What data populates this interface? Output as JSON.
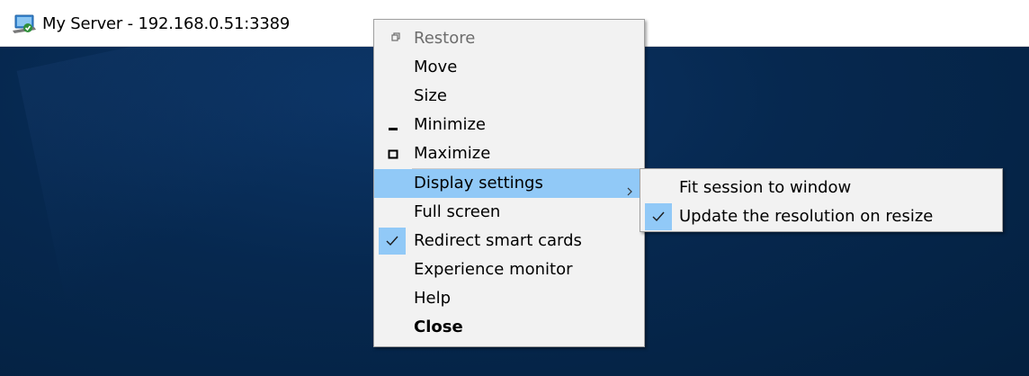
{
  "window": {
    "title": "My Server - 192.168.0.51:3389",
    "app_icon": "remote-desktop-icon"
  },
  "system_menu": {
    "items": [
      {
        "label": "Restore",
        "icon": "restore-icon",
        "state": "disabled"
      },
      {
        "label": "Move"
      },
      {
        "label": "Size"
      },
      {
        "label": "Minimize",
        "icon": "minimize-icon"
      },
      {
        "label": "Maximize",
        "icon": "maximize-icon"
      },
      {
        "label": "Display settings",
        "submenu": true,
        "state": "highlighted"
      },
      {
        "label": "Full screen"
      },
      {
        "label": "Redirect smart cards",
        "checked": true
      },
      {
        "label": "Experience monitor"
      },
      {
        "label": "Help"
      },
      {
        "label": "Close",
        "bold": true
      }
    ]
  },
  "display_settings_submenu": {
    "items": [
      {
        "label": "Fit session to window"
      },
      {
        "label": "Update the resolution on resize",
        "checked": true
      }
    ]
  },
  "colors": {
    "highlight": "#91c9f7",
    "menu_background": "#f2f2f2",
    "desktop_background": "#06284f",
    "disabled_text": "#6d6d6d"
  }
}
